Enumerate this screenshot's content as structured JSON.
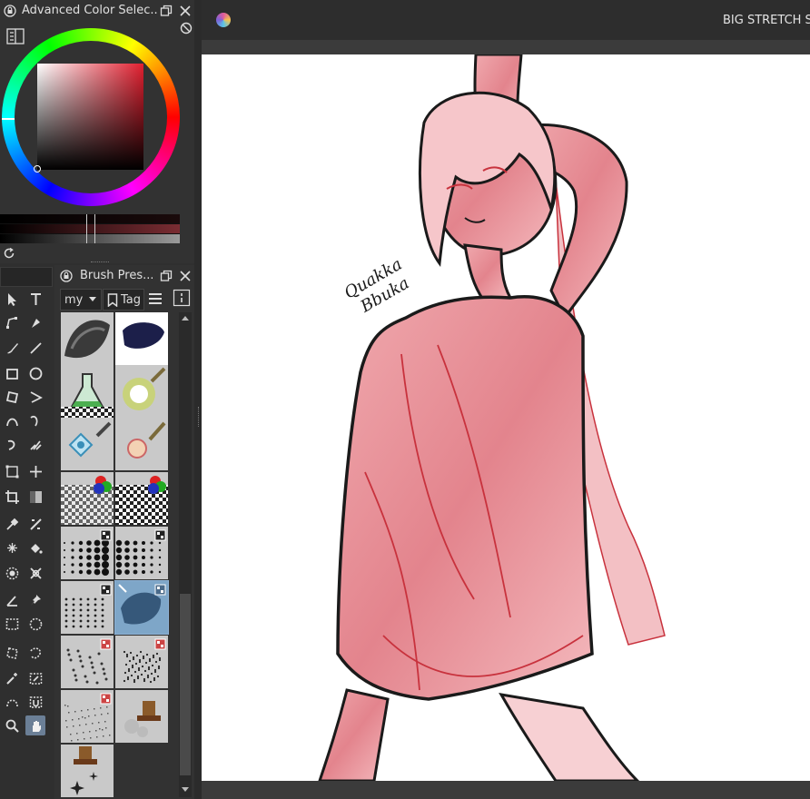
{
  "color_panel": {
    "title": "Advanced Color Selec..."
  },
  "brush_panel": {
    "title": "Brush Pres...",
    "tag_filter_value": "my",
    "tag_button_label": "Tag"
  },
  "canvas_tab": {
    "title": "BIG STRETCH S"
  },
  "signature": {
    "line1": "Quakka",
    "line2": "Bbuka"
  },
  "colors": {
    "accent": "#6d8fb0",
    "panel_bg": "#323232",
    "canvas_bg": "#ffffff",
    "skin": "#e8929a",
    "line": "#1a1a1a"
  },
  "tools": [
    "select-shapes-icon",
    "text-icon",
    "edit-shapes-icon",
    "calligraphy-icon",
    "freehand-brush-icon",
    "line-icon",
    "rectangle-icon",
    "ellipse-icon",
    "polygon-icon",
    "polyline-icon",
    "bezier-icon",
    "freehand-path-icon",
    "dynamic-brush-icon",
    "multibrush-icon",
    "transform-icon",
    "move-icon",
    "crop-icon",
    "gradient-icon",
    "color-picker-icon",
    "colorize-mask-icon",
    "smart-patch-icon",
    "fill-icon",
    "enclose-fill-icon",
    "assistant-icon",
    "measure-icon",
    "reference-icon",
    "rect-select-icon",
    "ellipse-select-icon",
    "polygon-select-icon",
    "freehand-select-icon",
    "magic-wand-icon",
    "similar-select-icon",
    "bezier-select-icon",
    "magnetic-select-icon",
    "zoom-icon",
    "pan-icon"
  ],
  "brush_presets": [
    "ink-blob-preset",
    "ink-dark-blue-preset",
    "flask-preset",
    "ring-preset",
    "diamond-preset",
    "circle-brush-preset",
    "checker-rgb-preset",
    "checker-rgb-preset-2",
    "halftone-preset",
    "halftone-preset-2",
    "halftone-small-preset",
    "texture-blue-preset",
    "spray-preset",
    "spray-dense-preset",
    "grain-preset",
    "stamp-preset",
    "stars-preset"
  ]
}
